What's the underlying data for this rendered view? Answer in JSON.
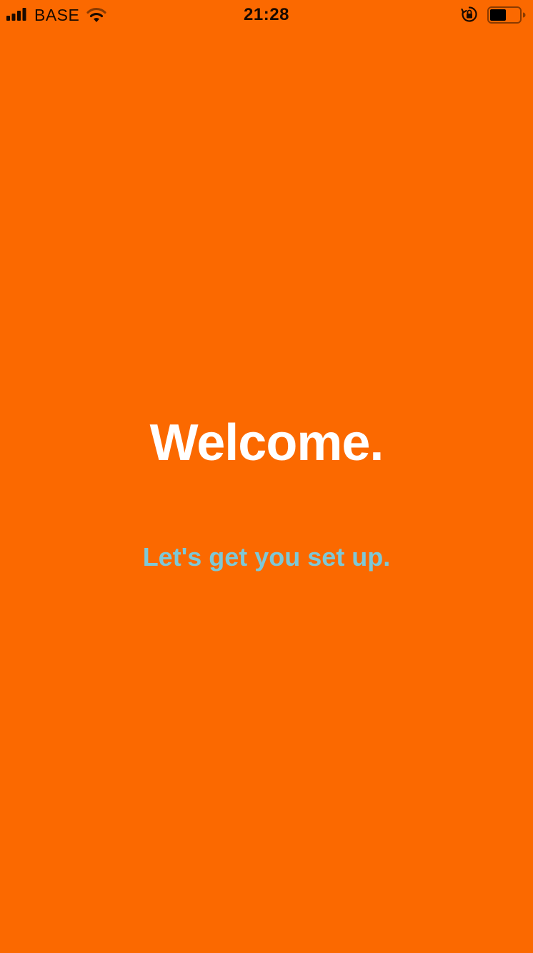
{
  "status_bar": {
    "carrier": "BASE",
    "time": "21:28",
    "signal_icon": "cellular-signal-icon",
    "wifi_icon": "wifi-icon",
    "rotation_lock_icon": "rotation-lock-icon",
    "battery_icon": "battery-icon",
    "battery_level": 0.5
  },
  "welcome": {
    "title": "Welcome.",
    "subtitle": "Let's get you set up."
  },
  "colors": {
    "background": "#FB6900",
    "title": "#FFFFFF",
    "subtitle": "#7EC8D6",
    "status_text": "#1A0A00"
  }
}
